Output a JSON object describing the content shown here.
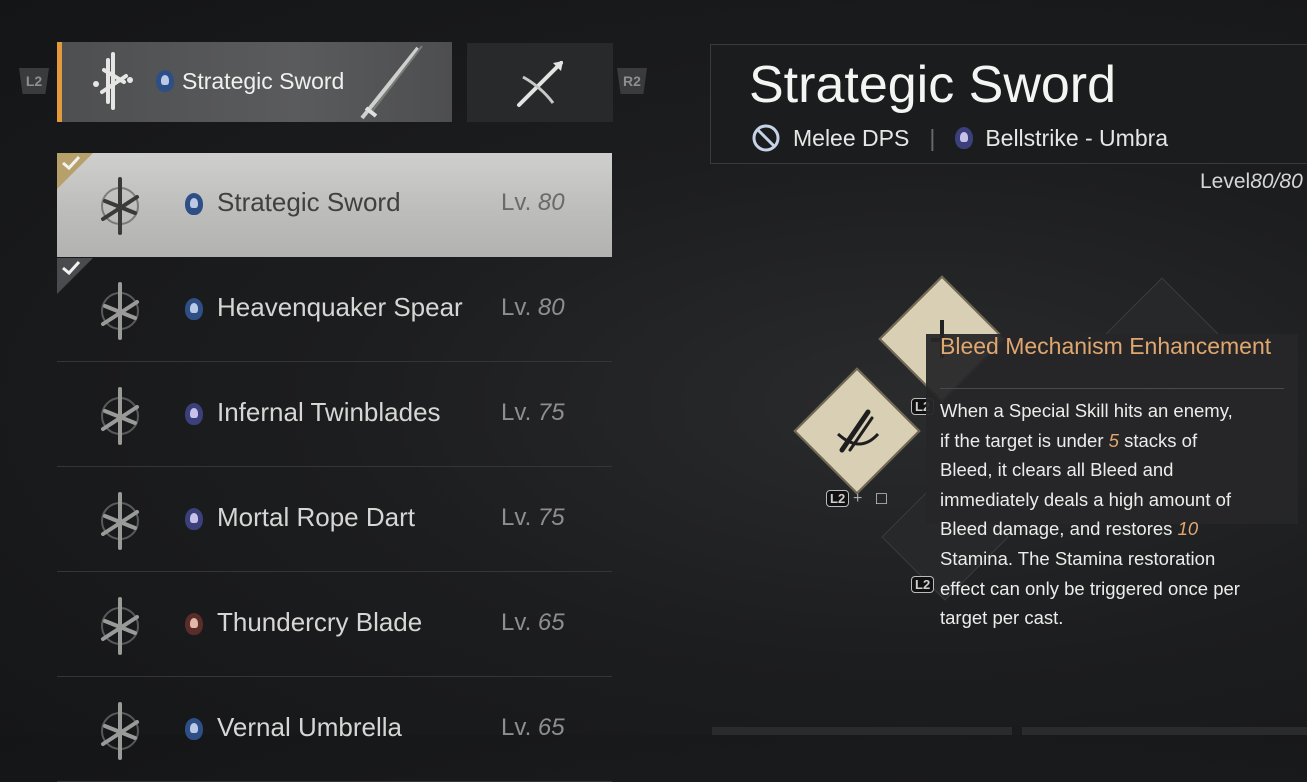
{
  "tabs": {
    "left_hint": "L2",
    "right_hint": "R2",
    "active_label": "Strategic Sword",
    "active_icon": "strategic-sword-glyph-icon",
    "inactive_icon": "spear-glyph-icon"
  },
  "weapons": [
    {
      "name": "Strategic Sword",
      "lv_prefix": "Lv.",
      "lv": "80",
      "icon": "strategic-sword-icon",
      "badge": "bellstrike",
      "checked": true,
      "selected": true
    },
    {
      "name": "Heavenquaker Spear",
      "lv_prefix": "Lv.",
      "lv": "80",
      "icon": "heavenquaker-spear-icon",
      "badge": "bellstrike",
      "checked": true,
      "selected": false
    },
    {
      "name": "Infernal Twinblades",
      "lv_prefix": "Lv.",
      "lv": "75",
      "icon": "infernal-twinblades-icon",
      "badge": "umbra",
      "checked": false,
      "selected": false
    },
    {
      "name": "Mortal Rope Dart",
      "lv_prefix": "Lv.",
      "lv": "75",
      "icon": "mortal-rope-dart-icon",
      "badge": "umbra",
      "checked": false,
      "selected": false
    },
    {
      "name": "Thundercry Blade",
      "lv_prefix": "Lv.",
      "lv": "65",
      "icon": "thundercry-blade-icon",
      "badge": "stone",
      "checked": false,
      "selected": false
    },
    {
      "name": "Vernal Umbrella",
      "lv_prefix": "Lv.",
      "lv": "65",
      "icon": "vernal-umbrella-icon",
      "badge": "bellstrike",
      "checked": false,
      "selected": false
    }
  ],
  "detail": {
    "title": "Strategic Sword",
    "role": "Melee DPS",
    "separator": "|",
    "path": "Bellstrike - Umbra",
    "level_label": "Level",
    "level_value": "80/80"
  },
  "skill_keys": {
    "l2": "L2",
    "plus": "+",
    "square": "□"
  },
  "tooltip": {
    "title": "Bleed Mechanism Enhancement",
    "body_parts": [
      {
        "t": "When a Special Skill hits an enemy, if the target is under ",
        "hl": false
      },
      {
        "t": "5",
        "hl": true
      },
      {
        "t": " stacks of Bleed, it clears all Bleed and immediately deals a high amount of Bleed damage, and restores ",
        "hl": false
      },
      {
        "t": "10",
        "hl": true
      },
      {
        "t": " Stamina. The Stamina restoration effect can only be triggered once per target per cast.",
        "hl": false
      }
    ]
  },
  "colors": {
    "accent": "#e29a3d",
    "tooltip_title": "#e0a76f",
    "highlight_number": "#e0a76f"
  }
}
